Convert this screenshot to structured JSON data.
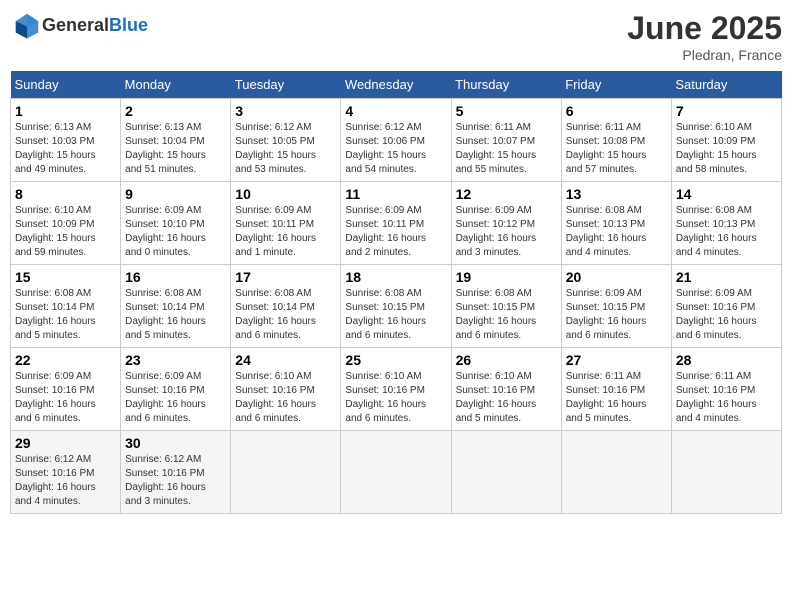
{
  "header": {
    "logo_general": "General",
    "logo_blue": "Blue",
    "month_year": "June 2025",
    "location": "Pledran, France"
  },
  "weekdays": [
    "Sunday",
    "Monday",
    "Tuesday",
    "Wednesday",
    "Thursday",
    "Friday",
    "Saturday"
  ],
  "weeks": [
    [
      {
        "day": "1",
        "info": "Sunrise: 6:13 AM\nSunset: 10:03 PM\nDaylight: 15 hours\nand 49 minutes."
      },
      {
        "day": "2",
        "info": "Sunrise: 6:13 AM\nSunset: 10:04 PM\nDaylight: 15 hours\nand 51 minutes."
      },
      {
        "day": "3",
        "info": "Sunrise: 6:12 AM\nSunset: 10:05 PM\nDaylight: 15 hours\nand 53 minutes."
      },
      {
        "day": "4",
        "info": "Sunrise: 6:12 AM\nSunset: 10:06 PM\nDaylight: 15 hours\nand 54 minutes."
      },
      {
        "day": "5",
        "info": "Sunrise: 6:11 AM\nSunset: 10:07 PM\nDaylight: 15 hours\nand 55 minutes."
      },
      {
        "day": "6",
        "info": "Sunrise: 6:11 AM\nSunset: 10:08 PM\nDaylight: 15 hours\nand 57 minutes."
      },
      {
        "day": "7",
        "info": "Sunrise: 6:10 AM\nSunset: 10:09 PM\nDaylight: 15 hours\nand 58 minutes."
      }
    ],
    [
      {
        "day": "8",
        "info": "Sunrise: 6:10 AM\nSunset: 10:09 PM\nDaylight: 15 hours\nand 59 minutes."
      },
      {
        "day": "9",
        "info": "Sunrise: 6:09 AM\nSunset: 10:10 PM\nDaylight: 16 hours\nand 0 minutes."
      },
      {
        "day": "10",
        "info": "Sunrise: 6:09 AM\nSunset: 10:11 PM\nDaylight: 16 hours\nand 1 minute."
      },
      {
        "day": "11",
        "info": "Sunrise: 6:09 AM\nSunset: 10:11 PM\nDaylight: 16 hours\nand 2 minutes."
      },
      {
        "day": "12",
        "info": "Sunrise: 6:09 AM\nSunset: 10:12 PM\nDaylight: 16 hours\nand 3 minutes."
      },
      {
        "day": "13",
        "info": "Sunrise: 6:08 AM\nSunset: 10:13 PM\nDaylight: 16 hours\nand 4 minutes."
      },
      {
        "day": "14",
        "info": "Sunrise: 6:08 AM\nSunset: 10:13 PM\nDaylight: 16 hours\nand 4 minutes."
      }
    ],
    [
      {
        "day": "15",
        "info": "Sunrise: 6:08 AM\nSunset: 10:14 PM\nDaylight: 16 hours\nand 5 minutes."
      },
      {
        "day": "16",
        "info": "Sunrise: 6:08 AM\nSunset: 10:14 PM\nDaylight: 16 hours\nand 5 minutes."
      },
      {
        "day": "17",
        "info": "Sunrise: 6:08 AM\nSunset: 10:14 PM\nDaylight: 16 hours\nand 6 minutes."
      },
      {
        "day": "18",
        "info": "Sunrise: 6:08 AM\nSunset: 10:15 PM\nDaylight: 16 hours\nand 6 minutes."
      },
      {
        "day": "19",
        "info": "Sunrise: 6:08 AM\nSunset: 10:15 PM\nDaylight: 16 hours\nand 6 minutes."
      },
      {
        "day": "20",
        "info": "Sunrise: 6:09 AM\nSunset: 10:15 PM\nDaylight: 16 hours\nand 6 minutes."
      },
      {
        "day": "21",
        "info": "Sunrise: 6:09 AM\nSunset: 10:16 PM\nDaylight: 16 hours\nand 6 minutes."
      }
    ],
    [
      {
        "day": "22",
        "info": "Sunrise: 6:09 AM\nSunset: 10:16 PM\nDaylight: 16 hours\nand 6 minutes."
      },
      {
        "day": "23",
        "info": "Sunrise: 6:09 AM\nSunset: 10:16 PM\nDaylight: 16 hours\nand 6 minutes."
      },
      {
        "day": "24",
        "info": "Sunrise: 6:10 AM\nSunset: 10:16 PM\nDaylight: 16 hours\nand 6 minutes."
      },
      {
        "day": "25",
        "info": "Sunrise: 6:10 AM\nSunset: 10:16 PM\nDaylight: 16 hours\nand 6 minutes."
      },
      {
        "day": "26",
        "info": "Sunrise: 6:10 AM\nSunset: 10:16 PM\nDaylight: 16 hours\nand 5 minutes."
      },
      {
        "day": "27",
        "info": "Sunrise: 6:11 AM\nSunset: 10:16 PM\nDaylight: 16 hours\nand 5 minutes."
      },
      {
        "day": "28",
        "info": "Sunrise: 6:11 AM\nSunset: 10:16 PM\nDaylight: 16 hours\nand 4 minutes."
      }
    ],
    [
      {
        "day": "29",
        "info": "Sunrise: 6:12 AM\nSunset: 10:16 PM\nDaylight: 16 hours\nand 4 minutes."
      },
      {
        "day": "30",
        "info": "Sunrise: 6:12 AM\nSunset: 10:16 PM\nDaylight: 16 hours\nand 3 minutes."
      },
      {
        "day": "",
        "info": ""
      },
      {
        "day": "",
        "info": ""
      },
      {
        "day": "",
        "info": ""
      },
      {
        "day": "",
        "info": ""
      },
      {
        "day": "",
        "info": ""
      }
    ]
  ]
}
